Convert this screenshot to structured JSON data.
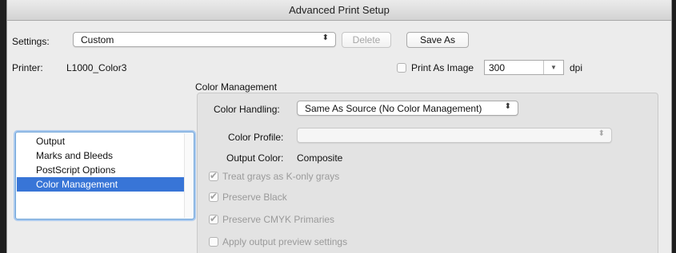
{
  "window": {
    "title": "Advanced Print Setup"
  },
  "settings": {
    "label": "Settings:",
    "value": "Custom",
    "delete_label": "Delete",
    "save_as_label": "Save As"
  },
  "printer": {
    "label": "Printer:",
    "value": "L1000_Color3",
    "print_as_image_label": "Print As Image",
    "print_as_image_checked": false,
    "dpi_value": "300",
    "dpi_unit": "dpi"
  },
  "sidebar": {
    "items": [
      {
        "label": "Output",
        "selected": false
      },
      {
        "label": "Marks and Bleeds",
        "selected": false
      },
      {
        "label": "PostScript Options",
        "selected": false
      },
      {
        "label": "Color Management",
        "selected": true
      }
    ]
  },
  "color_management": {
    "section_title": "Color Management",
    "color_handling_label": "Color Handling:",
    "color_handling_value": "Same As Source (No Color Management)",
    "color_profile_label": "Color Profile:",
    "color_profile_value": "",
    "output_color_label": "Output Color:",
    "output_color_value": "Composite",
    "options": [
      {
        "label": "Treat grays as K-only grays",
        "checked": true,
        "enabled": false
      },
      {
        "label": "Preserve Black",
        "checked": true,
        "enabled": false
      },
      {
        "label": "Preserve CMYK Primaries",
        "checked": true,
        "enabled": false
      },
      {
        "label": "Apply output preview settings",
        "checked": false,
        "enabled": false
      }
    ]
  },
  "icons": {
    "select_arrows": "updown-arrows-icon",
    "dropdown": "triangle-down-icon",
    "checkmark": "checkmark-icon"
  },
  "colors": {
    "selection": "#3875d7",
    "focus_ring": "#6fa4d8",
    "window_bg": "#ececec"
  }
}
